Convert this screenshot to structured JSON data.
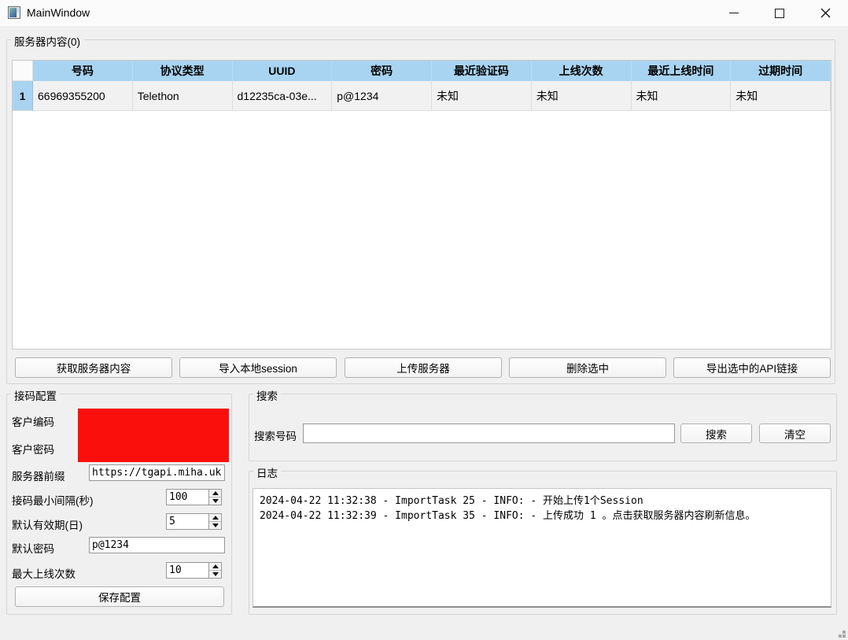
{
  "window": {
    "title": "MainWindow"
  },
  "server_panel": {
    "title": "服务器内容(0)",
    "table": {
      "columns": [
        "号码",
        "协议类型",
        "UUID",
        "密码",
        "最近验证码",
        "上线次数",
        "最近上线时间",
        "过期时间"
      ],
      "rows": [
        {
          "num": "1",
          "cells": [
            "66969355200",
            "Telethon",
            "d12235ca-03e...",
            "p@1234",
            "未知",
            "未知",
            "未知",
            "未知"
          ]
        }
      ]
    },
    "buttons": [
      {
        "label": "获取服务器内容"
      },
      {
        "label": "导入本地session"
      },
      {
        "label": "上传服务器"
      },
      {
        "label": "删除选中"
      },
      {
        "label": "导出选中的API链接"
      }
    ]
  },
  "config_panel": {
    "title": "接码配置",
    "client_code": {
      "label": "客户编码"
    },
    "client_password": {
      "label": "客户密码"
    },
    "server_prefix": {
      "label": "服务器前缀",
      "value": "https://tgapi.miha.uk"
    },
    "min_interval": {
      "label": "接码最小间隔(秒)",
      "value": "100"
    },
    "validity_days": {
      "label": "默认有效期(日)",
      "value": "5"
    },
    "default_password": {
      "label": "默认密码",
      "value": "p@1234"
    },
    "max_online": {
      "label": "最大上线次数",
      "value": "10"
    },
    "save_button": {
      "label": "保存配置"
    },
    "redaction_color": "#fb0f0c"
  },
  "search_panel": {
    "title": "搜索",
    "field_label": "搜索号码",
    "input_value": "",
    "search_button": "搜索",
    "clear_button": "清空"
  },
  "log_panel": {
    "title": "日志",
    "lines": [
      "2024-04-22 11:32:38 - ImportTask 25 - INFO: - 开始上传1个Session",
      "2024-04-22 11:32:39 - ImportTask 35 - INFO: - 上传成功 1 。点击获取服务器内容刷新信息。"
    ]
  },
  "colors": {
    "table_header": "#a9d4f1",
    "row_background": "#f1f1f1",
    "window_background": "#f0f0f0"
  }
}
